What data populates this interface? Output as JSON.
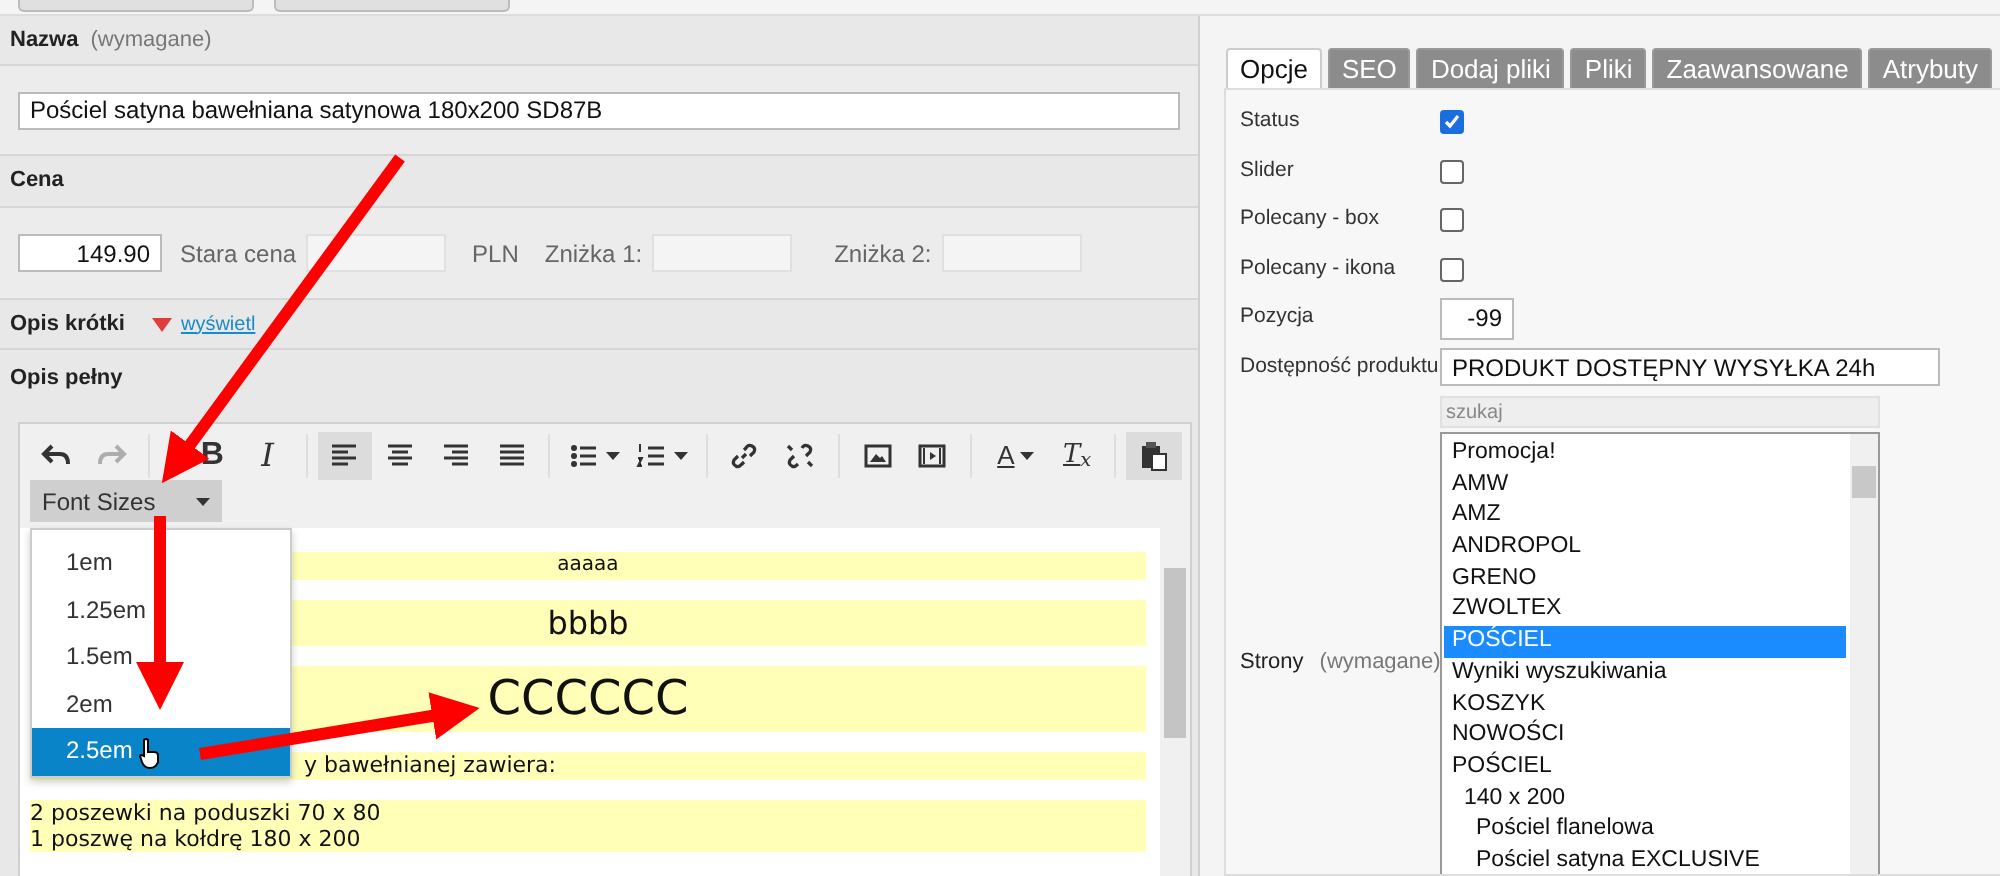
{
  "name_section": {
    "label": "Nazwa",
    "hint": "(wymagane)",
    "value": "Pościel satyna bawełniana satynowa 180x200 SD87B"
  },
  "price_section": {
    "label": "Cena",
    "price": "149.90",
    "old_price_label": "Stara cena",
    "currency": "PLN",
    "discount1_label": "Zniżka 1:",
    "discount2_label": "Zniżka 2:"
  },
  "short_description": {
    "label": "Opis krótki",
    "toggle": "wyświetl"
  },
  "full_description": {
    "label": "Opis pełny"
  },
  "editor": {
    "toolbar": [
      {
        "kind": "undo",
        "disabled": false,
        "active": false
      },
      {
        "kind": "redo",
        "disabled": true,
        "active": false
      },
      {
        "kind": "bold",
        "label": "B",
        "disabled": false,
        "active": false
      },
      {
        "kind": "italic",
        "label": "I",
        "disabled": false,
        "active": false
      },
      {
        "kind": "align-left",
        "disabled": false,
        "active": true
      },
      {
        "kind": "align-center",
        "disabled": false,
        "active": false
      },
      {
        "kind": "align-right",
        "disabled": false,
        "active": false
      },
      {
        "kind": "justify",
        "disabled": false,
        "active": false
      },
      {
        "kind": "bullet-list",
        "disabled": false,
        "active": false
      },
      {
        "kind": "numbered-list",
        "disabled": false,
        "active": false
      },
      {
        "kind": "link",
        "disabled": false,
        "active": false
      },
      {
        "kind": "unlink",
        "disabled": false,
        "active": false
      },
      {
        "kind": "image",
        "disabled": false,
        "active": false
      },
      {
        "kind": "media",
        "disabled": false,
        "active": false
      },
      {
        "kind": "text-color",
        "label": "A",
        "disabled": false,
        "active": false
      },
      {
        "kind": "clear-format",
        "label": "T$_{x}$",
        "disabled": false,
        "active": false
      },
      {
        "kind": "paste",
        "disabled": false,
        "active": true
      }
    ],
    "font_sizes": {
      "label": "Font Sizes",
      "expanded": true,
      "options": [
        {
          "label": "1em",
          "selected": false
        },
        {
          "label": "1.25em",
          "selected": false
        },
        {
          "label": "1.5em",
          "selected": false
        },
        {
          "label": "2em",
          "selected": false
        },
        {
          "label": "2.5em",
          "selected": true
        }
      ]
    },
    "content": [
      {
        "kind": "small",
        "text": "aaaaa"
      },
      {
        "kind": "medium",
        "text": "bbbb"
      },
      {
        "kind": "large",
        "text": "CCCCCC"
      },
      {
        "kind": "partial",
        "text": "y bawełnianej zawiera:"
      },
      {
        "kind": "lines",
        "lines": [
          "2  poszewki na poduszki 70 x 80",
          "1  poszwę na kołdrę 180 x 200"
        ]
      }
    ]
  },
  "tabs": [
    {
      "label": "Opcje",
      "selected": true
    },
    {
      "label": "SEO",
      "selected": false
    },
    {
      "label": "Dodaj pliki",
      "selected": false
    },
    {
      "label": "Pliki",
      "selected": false
    },
    {
      "label": "Zaawansowane",
      "selected": false
    },
    {
      "label": "Atrybuty",
      "selected": false
    }
  ],
  "options": [
    {
      "kind": "checkbox",
      "label": "Status",
      "checked": true
    },
    {
      "kind": "checkbox",
      "label": "Slider",
      "checked": false
    },
    {
      "kind": "checkbox",
      "label": "Polecany - box",
      "checked": false
    },
    {
      "kind": "checkbox",
      "label": "Polecany - ikona",
      "checked": false
    },
    {
      "kind": "number",
      "label": "Pozycja",
      "value": "-99"
    },
    {
      "kind": "text",
      "label": "Dostępność produktu",
      "value": "PRODUKT DOSTĘPNY WYSYŁKA 24h"
    }
  ],
  "pages": {
    "label": "Strony",
    "hint": "(wymagane)",
    "search_placeholder": "szukaj",
    "items": [
      {
        "label": "Promocja!",
        "selected": false
      },
      {
        "label": "AMW",
        "selected": false
      },
      {
        "label": "AMZ",
        "selected": false
      },
      {
        "label": "ANDROPOL",
        "selected": false
      },
      {
        "label": "GRENO",
        "selected": false
      },
      {
        "label": "ZWOLTEX",
        "selected": false
      },
      {
        "label": "POŚCIEL",
        "selected": true
      },
      {
        "label": "Wyniki wyszukiwania",
        "selected": false
      },
      {
        "label": "KOSZYK",
        "selected": false
      },
      {
        "label": "NOWOŚCI",
        "selected": false
      },
      {
        "label": "POŚCIEL",
        "selected": false,
        "children": [
          {
            "label": "140 x 200",
            "selected": false,
            "children": [
              {
                "label": "Pościel flanelowa",
                "selected": false
              },
              {
                "label": "Pościel satyna EXCLUSIVE",
                "selected": false
              }
            ]
          }
        ]
      }
    ]
  }
}
